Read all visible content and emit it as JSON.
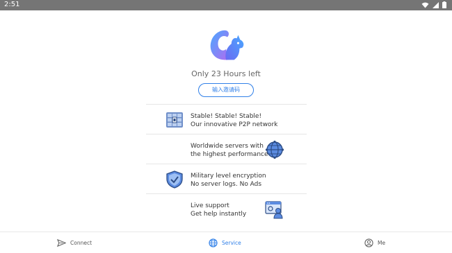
{
  "status_bar": {
    "time": "2:51",
    "icons": [
      "wifi-icon",
      "cellular-signal-icon",
      "battery-icon"
    ]
  },
  "header": {
    "logo_icon": "squirrel-logo-icon",
    "time_left": "Only 23 Hours left",
    "invite_button": "输入邀请码"
  },
  "features": [
    {
      "line1": "Stable! Stable! Stable!",
      "line2": "Our innovative P2P network",
      "icon": "server-rack-icon"
    },
    {
      "line1": "Worldwide servers with",
      "line2": "the highest performance",
      "icon": "globe-icon"
    },
    {
      "line1": "Military level encryption",
      "line2": "No server logs. No Ads",
      "icon": "shield-check-icon"
    },
    {
      "line1": "Live support",
      "line2": "Get help instantly",
      "icon": "support-agent-icon"
    }
  ],
  "bottom_nav": {
    "items": [
      {
        "label": "Connect",
        "icon": "plane-icon"
      },
      {
        "label": "Service",
        "icon": "globe-icon"
      },
      {
        "label": "Me",
        "icon": "user-icon"
      }
    ]
  },
  "colors": {
    "accent": "#2f7fe8",
    "status_bar": "#757575",
    "logo_gradient_start": "#4aa8ff",
    "logo_gradient_end": "#b06cf0"
  }
}
